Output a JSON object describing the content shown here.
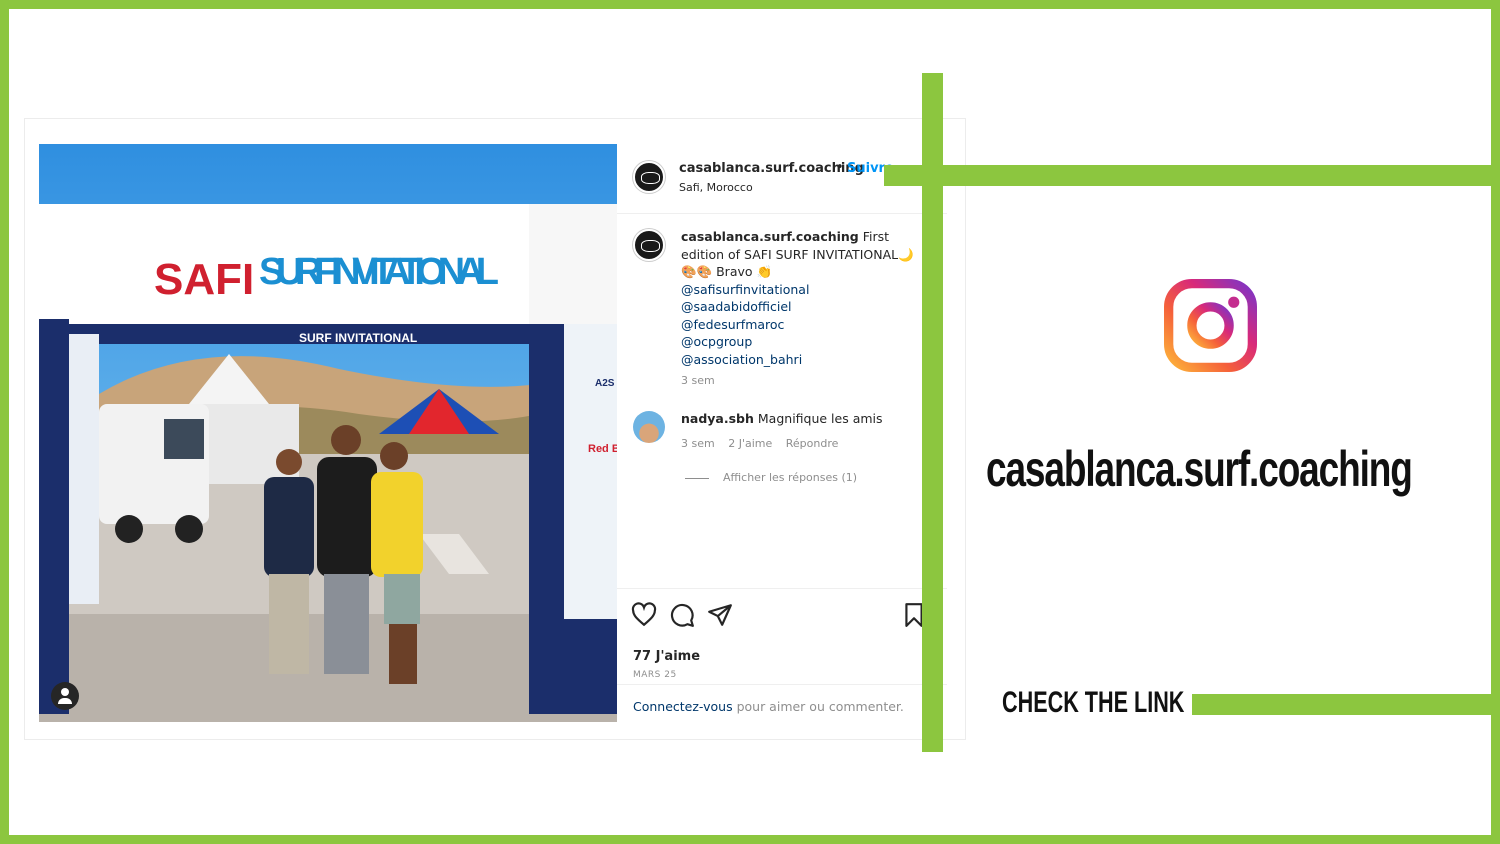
{
  "post": {
    "username": "casablanca.surf.coaching",
    "separator": "•",
    "follow_label": "Suivre",
    "location": "Safi, Morocco",
    "caption_user": "casablanca.surf.coaching",
    "caption_text": "First edition of SAFI SURF INVITATIONAL🌙🎨🎨 Bravo 👏",
    "tags": [
      "@safisurfinvitational",
      "@saadabidofficiel",
      "@fedesurfmaroc",
      "@ocpgroup",
      "@association_bahri"
    ],
    "caption_time": "3 sem",
    "comment": {
      "user": "nadya.sbh",
      "text": "Magnifique les amis",
      "time": "3 sem",
      "likes": "2 J'aime",
      "reply": "Répondre"
    },
    "view_replies": "Afficher les réponses (1)",
    "likes": "77 J'aime",
    "date": "MARS 25",
    "login_link": "Connectez-vous",
    "login_rest": " pour aimer ou commenter."
  },
  "photo": {
    "banner_left": "SAFI",
    "banner_right": "SURF INVITATIONAL",
    "sub_banner": "SURF INVITATIONAL",
    "pillar_text": "A2S",
    "redbull_text": "Red B"
  },
  "promo": {
    "handle": "casablanca.surf.coaching",
    "cta": "CHECK THE LINK"
  },
  "colors": {
    "frame_green": "#8cc63f",
    "link_blue": "#0095f6",
    "tag_blue": "#00376b"
  },
  "icons": [
    "heart-icon",
    "comment-icon",
    "share-icon",
    "bookmark-icon",
    "instagram-icon",
    "user-icon"
  ]
}
